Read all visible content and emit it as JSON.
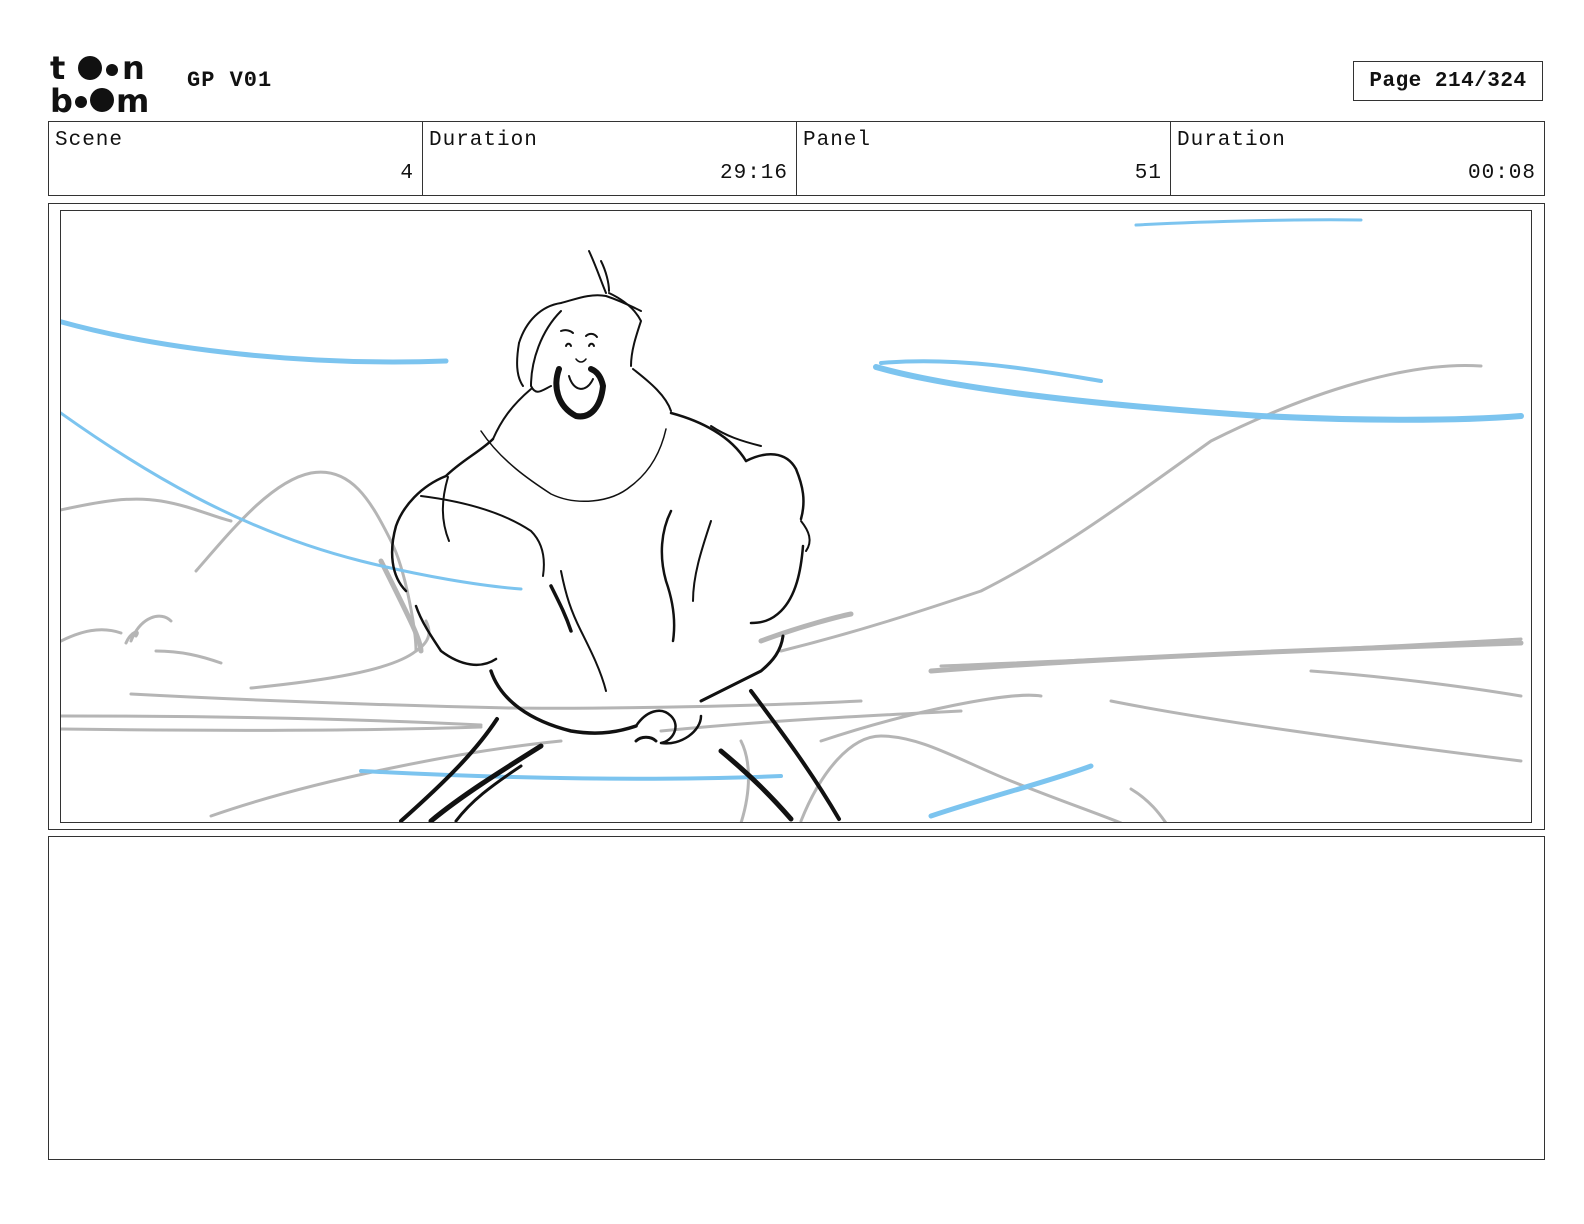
{
  "header": {
    "logo": "toon-boom-logo",
    "project": "GP V01",
    "page": "Page 214/324"
  },
  "info": {
    "scene_label": "Scene",
    "scene_value": "4",
    "scene_duration_label": "Duration",
    "scene_duration_value": "29:16",
    "panel_label": "Panel",
    "panel_value": "51",
    "panel_duration_label": "Duration",
    "panel_duration_value": "00:08"
  },
  "colors": {
    "sketch_black": "#111111",
    "sketch_gray": "#b5b5b5",
    "sketch_blue": "#7cc4ef"
  },
  "notes": ""
}
